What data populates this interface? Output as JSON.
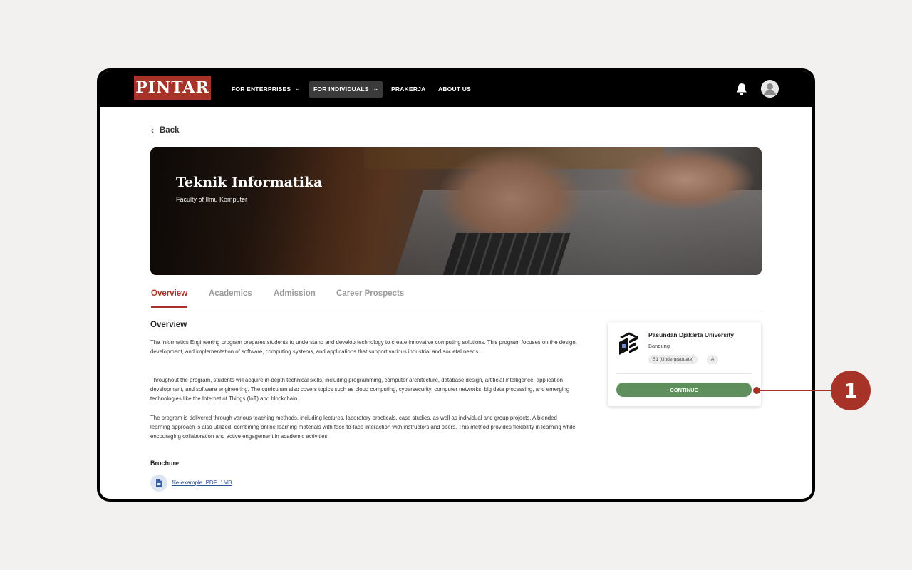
{
  "nav": {
    "logo": "PINTAR",
    "items": [
      {
        "label": "FOR ENTERPRISES",
        "dropdown": true
      },
      {
        "label": "FOR INDIVIDUALS",
        "dropdown": true,
        "active": true
      },
      {
        "label": "PRAKERJA",
        "dropdown": false
      },
      {
        "label": "ABOUT US",
        "dropdown": false
      }
    ],
    "chevron": "⌄"
  },
  "back_label": "Back",
  "hero": {
    "title": "Teknik Informatika",
    "subtitle": "Faculty of Ilmu Komputer"
  },
  "tabs": [
    {
      "label": "Overview",
      "active": true
    },
    {
      "label": "Academics"
    },
    {
      "label": "Admission"
    },
    {
      "label": "Career Prospects"
    }
  ],
  "overview": {
    "heading": "Overview",
    "paragraphs": [
      "The Informatics Engineering program prepares students to understand and develop technology to create innovative computing solutions. This program focuses on the design, development, and implementation of software, computing systems, and applications that support various industrial and societal needs.",
      "Throughout the program, students will acquire in-depth technical skills, including programming, computer architecture, database design, artificial intelligence, application development, and software engineering. The curriculum also covers topics such as cloud computing, cybersecurity, computer networks, big data processing, and emerging technologies like the Internet of Things (IoT) and blockchain.",
      "The program is delivered through various teaching methods, including lectures, laboratory practicals, case studies, as well as individual and group projects. A blended learning approach is also utilized, combining online learning materials with face-to-face interaction with instructors and peers. This method provides flexibility in learning while encouraging collaboration and active engagement in academic activities."
    ],
    "brochure_label": "Brochure",
    "brochure_file": "file-example_PDF_1MB"
  },
  "university_card": {
    "name": "Pasundan Djakarta University",
    "city": "Bandung",
    "badges": [
      "S1 (Undergraduate)",
      "A"
    ],
    "button_label": "CONTINUE"
  },
  "callout": {
    "number": "1",
    "color": "#a73227"
  },
  "colors": {
    "brand": "#a73227",
    "button": "#5e8f5c",
    "link": "#2a4d8f"
  }
}
